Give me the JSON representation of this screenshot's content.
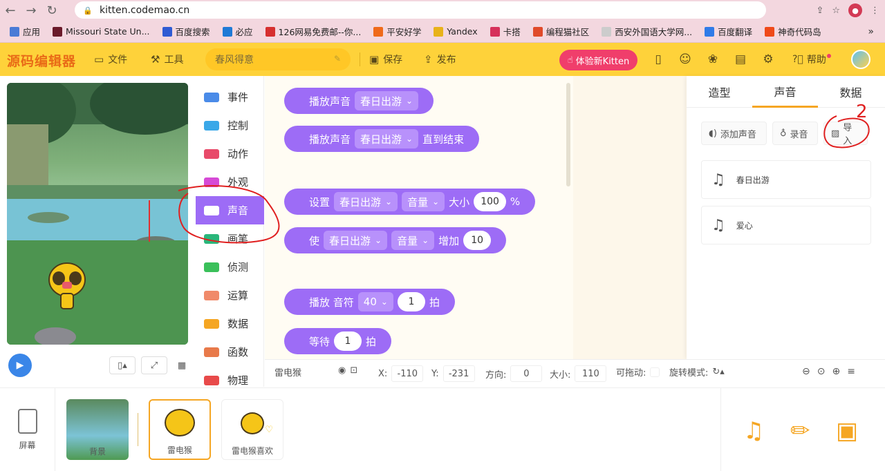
{
  "browser": {
    "url": "kitten.codemao.cn",
    "bookmarks": [
      {
        "label": "应用",
        "color": "#4a7bd6"
      },
      {
        "label": "Missouri State Un...",
        "color": "#6b1a2a"
      },
      {
        "label": "百度搜索",
        "color": "#2f5bd3"
      },
      {
        "label": "必应",
        "color": "#1f7ad6"
      },
      {
        "label": "126网易免费邮--你...",
        "color": "#d62f2f"
      },
      {
        "label": "平安好学",
        "color": "#ef6a1a"
      },
      {
        "label": "Yandex",
        "color": "#e8b21a"
      },
      {
        "label": "卡搭",
        "color": "#d6305a"
      },
      {
        "label": "编程猫社区",
        "color": "#e04a2a"
      },
      {
        "label": "西安外国语大学网...",
        "color": "#cccccc"
      },
      {
        "label": "百度翻译",
        "color": "#2f7be8"
      },
      {
        "label": "神奇代码岛",
        "color": "#ef4a1a"
      }
    ],
    "more": "»"
  },
  "toolbar": {
    "logo": "源码编辑器",
    "file": "文件",
    "tools": "工具",
    "project_name": "春风得意",
    "save": "保存",
    "publish": "发布",
    "try_new": "体验新Kitten",
    "help": "帮助"
  },
  "categories": [
    {
      "label": "事件",
      "color": "#4a8be8"
    },
    {
      "label": "控制",
      "color": "#3aa8e8"
    },
    {
      "label": "动作",
      "color": "#e84a6a"
    },
    {
      "label": "外观",
      "color": "#d64ad6"
    },
    {
      "label": "声音",
      "color": "#9d6cf6"
    },
    {
      "label": "画笔",
      "color": "#2ab67a"
    },
    {
      "label": "侦测",
      "color": "#3ac05a"
    },
    {
      "label": "运算",
      "color": "#f08a6a"
    },
    {
      "label": "数据",
      "color": "#f5a623"
    },
    {
      "label": "函数",
      "color": "#e87a4a"
    },
    {
      "label": "物理",
      "color": "#e84a4a"
    }
  ],
  "blocks": {
    "b1": {
      "text": "播放声音",
      "dd": "春日出游"
    },
    "b2": {
      "text": "播放声音",
      "dd": "春日出游",
      "tail": "直到结束"
    },
    "b3": {
      "text": "设置",
      "dd1": "春日出游",
      "dd2": "音量",
      "mid": "大小",
      "num": "100",
      "unit": "%"
    },
    "b4": {
      "text": "使",
      "dd1": "春日出游",
      "dd2": "音量",
      "mid": "增加",
      "num": "10"
    },
    "b5": {
      "text": "播放 音符",
      "dd": "40",
      "num": "1",
      "tail": "拍"
    },
    "b6": {
      "text": "等待",
      "num": "1",
      "tail": "拍"
    }
  },
  "rpanel": {
    "tabs": [
      "造型",
      "声音",
      "数据"
    ],
    "add_sound": "添加声音",
    "record": "录音",
    "import": "导入",
    "sounds": [
      "春日出游",
      "爱心"
    ]
  },
  "props": {
    "name": "雷电猴",
    "x_label": "X:",
    "x": "-110",
    "y_label": "Y:",
    "y": "-231",
    "dir_label": "方向:",
    "dir": "0",
    "size_label": "大小:",
    "size": "110",
    "drag_label": "可拖动:",
    "rotate_label": "旋转模式:"
  },
  "sprites": {
    "screen": "屏幕",
    "bg": "背景",
    "s1": "雷电猴",
    "s2": "雷电猴喜欢"
  },
  "annotation": {
    "mark": "2"
  }
}
